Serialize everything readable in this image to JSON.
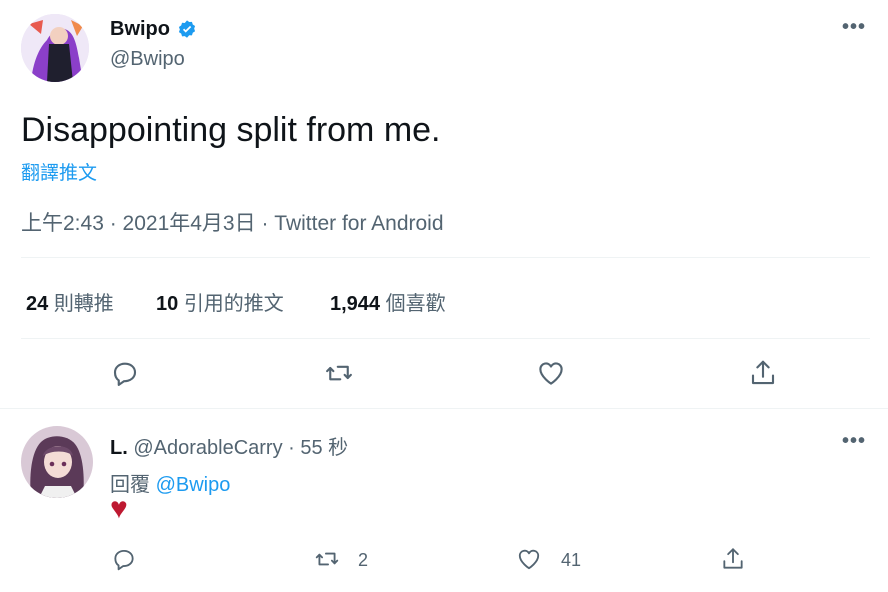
{
  "main_tweet": {
    "author": {
      "name": "Bwipo",
      "handle": "@Bwipo",
      "verified": true
    },
    "text": "Disappointing split from me.",
    "translate_label": "翻譯推文",
    "meta": "上午2:43 · 2021年4月3日 · Twitter for Android",
    "stats": {
      "retweets_count": "24",
      "retweets_label": "則轉推",
      "quotes_count": "10",
      "quotes_label": "引用的推文",
      "likes_count": "1,944",
      "likes_label": "個喜歡"
    },
    "more_label": "•••"
  },
  "reply": {
    "author": {
      "name": "L.",
      "handle": "@AdorableCarry"
    },
    "time": "· 55 秒",
    "replying_prefix": "回覆",
    "replying_to": "@Bwipo",
    "body_emoji": "♥",
    "retweet_count": "2",
    "like_count": "41",
    "more_label": "•••"
  },
  "colors": {
    "accent": "#1d9bf0",
    "heart": "#be1931",
    "text": "#0f1419",
    "muted": "#536471",
    "divider": "#eff3f4"
  }
}
